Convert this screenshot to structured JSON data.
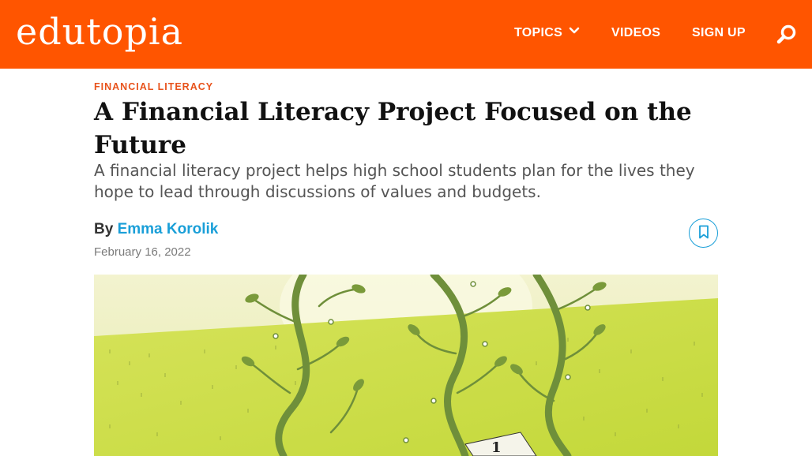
{
  "header": {
    "logo": "edutopia",
    "nav": [
      {
        "label": "TOPICS"
      },
      {
        "label": "VIDEOS"
      },
      {
        "label": "SIGN UP"
      }
    ],
    "brand_color": "#ff5500"
  },
  "article": {
    "kicker": "FINANCIAL LITERACY",
    "title": "A Financial Literacy Project Focused on the Future",
    "subtitle": "A financial literacy project helps high school students plan for the lives they hope to lead through discussions of values and budgets.",
    "by": "By",
    "author": "Emma Korolik",
    "date": "February 16, 2022"
  },
  "colors": {
    "kicker": "#e8531c",
    "author_link": "#1a9fd8",
    "hero_field": "#cfe04a"
  }
}
